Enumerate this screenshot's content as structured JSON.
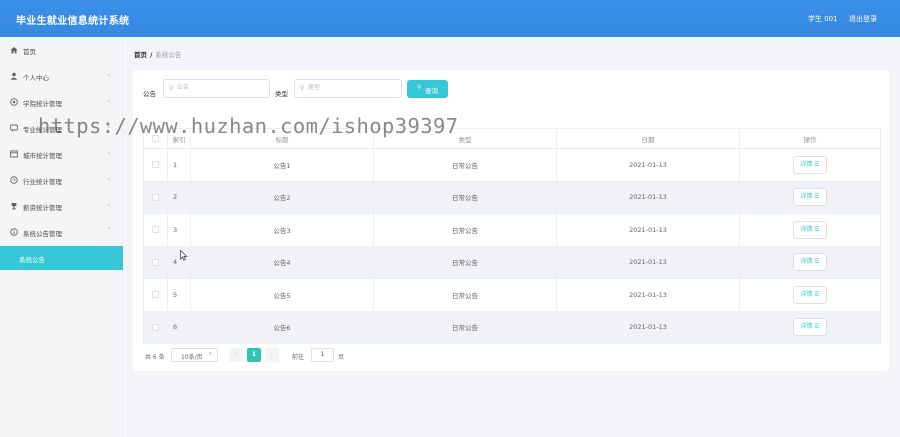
{
  "header": {
    "title": "毕业生就业信息统计系统",
    "user": "学生 001",
    "logout": "退出登录"
  },
  "sidebar": {
    "items": [
      {
        "label": "首页",
        "icon": "home-icon",
        "has_children": false
      },
      {
        "label": "个人中心",
        "icon": "person-icon",
        "has_children": true
      },
      {
        "label": "学院统计管理",
        "icon": "gear-circle-icon",
        "has_children": true
      },
      {
        "label": "专业统计管理",
        "icon": "chat-icon",
        "has_children": true
      },
      {
        "label": "城市统计管理",
        "icon": "window-icon",
        "has_children": true
      },
      {
        "label": "行业统计管理",
        "icon": "clock-icon",
        "has_children": true
      },
      {
        "label": "薪资统计管理",
        "icon": "trophy-icon",
        "has_children": true
      },
      {
        "label": "系统公告管理",
        "icon": "info-icon",
        "has_children": true,
        "expanded": true
      }
    ],
    "active_sub": "系统公告",
    "accent": "#36c7d6"
  },
  "breadcrumb": {
    "home": "首页",
    "separator": "/",
    "current": "系统公告"
  },
  "search": {
    "notice_label": "公告",
    "notice_placeholder": "公告",
    "type_label": "类型",
    "type_placeholder": "类型",
    "query_button": "查询"
  },
  "table": {
    "headers": [
      "",
      "索引",
      "标题",
      "类型",
      "日期",
      "操作"
    ],
    "rows": [
      {
        "index": "1",
        "title": "公告1",
        "type": "日常公告",
        "date": "2021-01-13",
        "action": "详情"
      },
      {
        "index": "2",
        "title": "公告2",
        "type": "日常公告",
        "date": "2021-01-13",
        "action": "详情"
      },
      {
        "index": "3",
        "title": "公告3",
        "type": "日常公告",
        "date": "2021-01-13",
        "action": "详情"
      },
      {
        "index": "4",
        "title": "公告4",
        "type": "日常公告",
        "date": "2021-01-13",
        "action": "详情"
      },
      {
        "index": "5",
        "title": "公告5",
        "type": "日常公告",
        "date": "2021-01-13",
        "action": "详情"
      },
      {
        "index": "6",
        "title": "公告6",
        "type": "日常公告",
        "date": "2021-01-13",
        "action": "详情"
      }
    ]
  },
  "pagination": {
    "total": "共 6 条",
    "page_size": "10条/页",
    "prev": "‹",
    "current_page": "1",
    "next": "›",
    "goto_label": "前往",
    "goto_value": "1",
    "page_unit": "页"
  },
  "watermark": "https://www.huzhan.com/ishop39397"
}
